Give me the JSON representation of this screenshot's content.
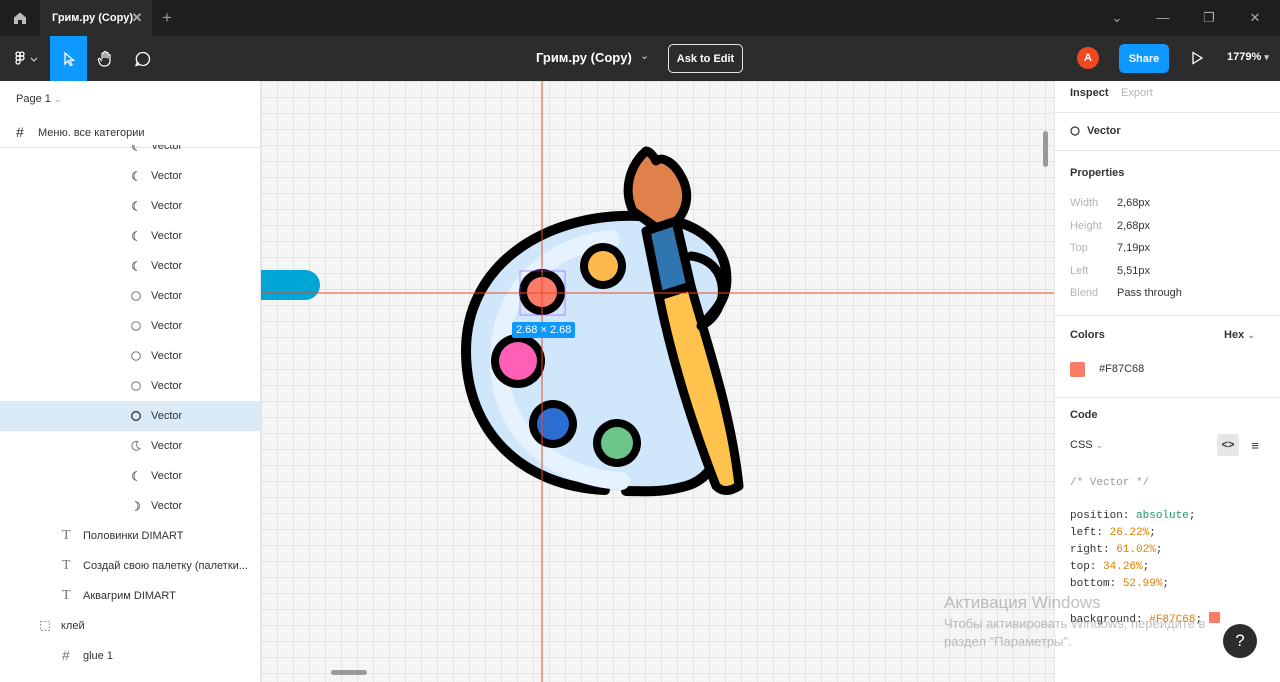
{
  "tab": {
    "title": "Грим.ру (Copy)"
  },
  "toolbar": {
    "file_title": "Грим.ру (Copy)",
    "ask_to_edit": "Ask to Edit",
    "avatar_initial": "A",
    "share": "Share",
    "zoom": "1779%"
  },
  "left": {
    "page": "Page 1",
    "frame": "Меню. все категории",
    "layers": [
      {
        "label": "Vector",
        "icon": "half-moon-icon"
      },
      {
        "label": "Vector",
        "icon": "half-moon-icon"
      },
      {
        "label": "Vector",
        "icon": "half-moon-icon"
      },
      {
        "label": "Vector",
        "icon": "half-moon-icon"
      },
      {
        "label": "Vector",
        "icon": "half-moon-icon"
      },
      {
        "label": "Vector",
        "icon": "circle-icon"
      },
      {
        "label": "Vector",
        "icon": "circle-icon"
      },
      {
        "label": "Vector",
        "icon": "circle-icon"
      },
      {
        "label": "Vector",
        "icon": "circle-icon"
      },
      {
        "label": "Vector",
        "icon": "circle-icon",
        "selected": true
      },
      {
        "label": "Vector",
        "icon": "crescent-icon"
      },
      {
        "label": "Vector",
        "icon": "half-moon-icon"
      },
      {
        "label": "Vector",
        "icon": "half-moon-icon"
      },
      {
        "label": "Половинки DIMART",
        "icon": "text-icon"
      },
      {
        "label": "Создай свою палетку (палетки...",
        "icon": "text-icon"
      },
      {
        "label": "Аквагрим DIMART",
        "icon": "text-icon"
      },
      {
        "label": "клей",
        "icon": "group-icon"
      },
      {
        "label": "glue 1",
        "icon": "frame-icon"
      }
    ]
  },
  "canvas": {
    "size_badge": "2.68 × 2.68"
  },
  "right": {
    "tab_inspect": "Inspect",
    "tab_export": "Export",
    "layer_name": "Vector",
    "properties_title": "Properties",
    "props": [
      {
        "label": "Width",
        "value": "2,68px"
      },
      {
        "label": "Height",
        "value": "2,68px"
      },
      {
        "label": "Top",
        "value": "7,19px"
      },
      {
        "label": "Left",
        "value": "5,51px"
      },
      {
        "label": "Blend",
        "value": "Pass through"
      }
    ],
    "colors_title": "Colors",
    "color_format": "Hex",
    "color_hex": "#F87C68",
    "color_swatch": "#F87C68",
    "code_title": "Code",
    "code_lang": "CSS",
    "code": {
      "comment": "/* Vector */",
      "position_key": "position: ",
      "position_val": "absolute",
      "left_key": "left: ",
      "left_val": "26.22%",
      "right_key": "right: ",
      "right_val": "61.02%",
      "top_key": "top: ",
      "top_val": "34.26%",
      "bottom_key": "bottom: ",
      "bottom_val": "52.99%",
      "bg_key": "background: ",
      "bg_val": "#F87C68"
    }
  },
  "watermark": {
    "title": "Активация Windows",
    "line1": "Чтобы активировать Windows, перейдите в",
    "line2": "раздел \"Параметры\"."
  },
  "help": "?"
}
